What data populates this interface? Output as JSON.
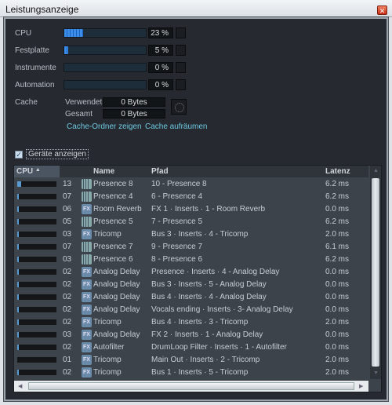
{
  "window": {
    "title": "Leistungsanzeige",
    "close_icon": "close-icon"
  },
  "meters": [
    {
      "label": "CPU",
      "value": "23 %",
      "fill": 0.23
    },
    {
      "label": "Festplatte",
      "value": "5 %",
      "fill": 0.05
    },
    {
      "label": "Instrumente",
      "value": "0 %",
      "fill": 0
    },
    {
      "label": "Automation",
      "value": "0 %",
      "fill": 0
    }
  ],
  "cache": {
    "label": "Cache",
    "used_label": "Verwendet",
    "used_value": "0 Bytes",
    "total_label": "Gesamt",
    "total_value": "0 Bytes",
    "show_folder_link": "Cache-Ordner zeigen",
    "cleanup_link": "Cache aufräumen"
  },
  "show_devices": {
    "label": "Geräte anzeigen",
    "checked": true
  },
  "table": {
    "columns": {
      "cpu": "CPU",
      "name": "Name",
      "path": "Pfad",
      "latency": "Latenz"
    },
    "rows": [
      {
        "cpu_fill": 0.1,
        "count": "13",
        "type": "instrument",
        "name": "Presence 8",
        "path": "10 - Presence 8",
        "latency": "6.2 ms"
      },
      {
        "cpu_fill": 0.04,
        "count": "07",
        "type": "instrument",
        "name": "Presence 4",
        "path": "6 - Presence 4",
        "latency": "6.2 ms"
      },
      {
        "cpu_fill": 0.04,
        "count": "06",
        "type": "fx",
        "name": "Room Reverb",
        "path": "FX 1 · Inserts · 1 - Room Reverb",
        "latency": "0.0 ms"
      },
      {
        "cpu_fill": 0.03,
        "count": "05",
        "type": "instrument",
        "name": "Presence 5",
        "path": "7 - Presence 5",
        "latency": "6.2 ms"
      },
      {
        "cpu_fill": 0.02,
        "count": "03",
        "type": "fx",
        "name": "Tricomp",
        "path": "Bus 3 · Inserts · 4 - Tricomp",
        "latency": "2.0 ms"
      },
      {
        "cpu_fill": 0.04,
        "count": "07",
        "type": "instrument",
        "name": "Presence 7",
        "path": "9 - Presence 7",
        "latency": "6.1 ms"
      },
      {
        "cpu_fill": 0.02,
        "count": "03",
        "type": "instrument",
        "name": "Presence 6",
        "path": "8 - Presence 6",
        "latency": "6.2 ms"
      },
      {
        "cpu_fill": 0.02,
        "count": "02",
        "type": "fx",
        "name": "Analog Delay",
        "path": "Presence · Inserts · 4 - Analog Delay",
        "latency": "0.0 ms"
      },
      {
        "cpu_fill": 0.02,
        "count": "02",
        "type": "fx",
        "name": "Analog Delay",
        "path": "Bus 3 · Inserts · 5 - Analog Delay",
        "latency": "0.0 ms"
      },
      {
        "cpu_fill": 0.02,
        "count": "02",
        "type": "fx",
        "name": "Analog Delay",
        "path": "Bus 4 · Inserts · 4 - Analog Delay",
        "latency": "0.0 ms"
      },
      {
        "cpu_fill": 0.02,
        "count": "02",
        "type": "fx",
        "name": "Analog Delay",
        "path": "Vocals ending · Inserts · 3- Analog Delay",
        "latency": "0.0 ms"
      },
      {
        "cpu_fill": 0.02,
        "count": "02",
        "type": "fx",
        "name": "Tricomp",
        "path": "Bus 4 · Inserts · 3 - Tricomp",
        "latency": "2.0 ms"
      },
      {
        "cpu_fill": 0.02,
        "count": "03",
        "type": "fx",
        "name": "Analog Delay",
        "path": "FX 2 · Inserts · 1 - Analog Delay",
        "latency": "0.0 ms"
      },
      {
        "cpu_fill": 0.02,
        "count": "02",
        "type": "fx",
        "name": "Autofilter",
        "path": "DrumLoop Filter · Inserts · 1 - Autofilter",
        "latency": "0.0 ms"
      },
      {
        "cpu_fill": 0.0,
        "count": "01",
        "type": "fx",
        "name": "Tricomp",
        "path": "Main Out · Inserts · 2 - Tricomp",
        "latency": "2.0 ms"
      },
      {
        "cpu_fill": 0.02,
        "count": "02",
        "type": "fx",
        "name": "Tricomp",
        "path": "Bus 1 · Inserts · 5 - Tricomp",
        "latency": "2.0 ms"
      }
    ]
  },
  "colors": {
    "panel": "#262a30",
    "list": "#3d434b",
    "accent": "#3a8ee8",
    "link": "#6ec8e0"
  }
}
